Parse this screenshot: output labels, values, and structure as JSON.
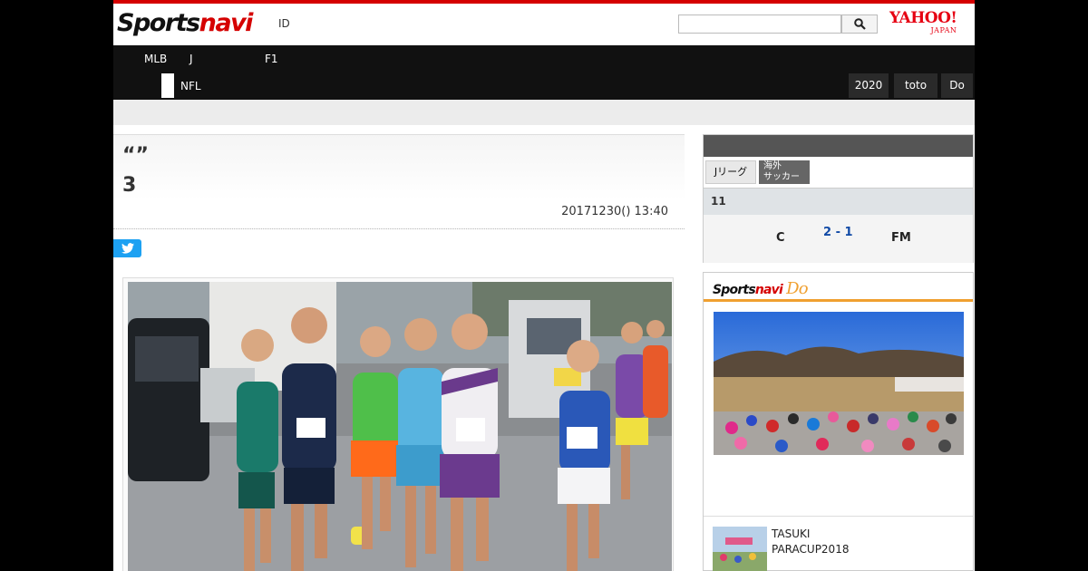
{
  "header": {
    "logo_main": "Sports",
    "logo_accent": "navi",
    "id_link": "ID",
    "search_placeholder": "",
    "yahoo_logo": "YAHOO!",
    "yahoo_sub": "JAPAN"
  },
  "nav": {
    "row1": [
      "MLB",
      "J",
      "F1"
    ],
    "row2_left": "NFL",
    "row2_right": [
      "2020",
      "toto",
      "Do"
    ]
  },
  "article": {
    "quote_marks": "“”",
    "headline": "3",
    "date": "20171230() 13:40"
  },
  "sidebar": {
    "tabs": [
      "Jリーグ",
      "海外",
      "サッカー"
    ],
    "round": "11",
    "match": {
      "home": "C",
      "score": "2 - 1",
      "away": "FM"
    },
    "do_logo_main": "Sports",
    "do_logo_accent": "navi",
    "do_logo_do": "Do",
    "item_text": [
      "TASUKI",
      "PARACUP2018"
    ]
  },
  "colors": {
    "brand_red": "#d50000",
    "nav_bg": "#111111",
    "twitter": "#1da1f2",
    "do_orange": "#f0a030",
    "score_blue": "#114aa6"
  },
  "icons": {
    "search": "search-icon",
    "twitter": "twitter-icon"
  }
}
